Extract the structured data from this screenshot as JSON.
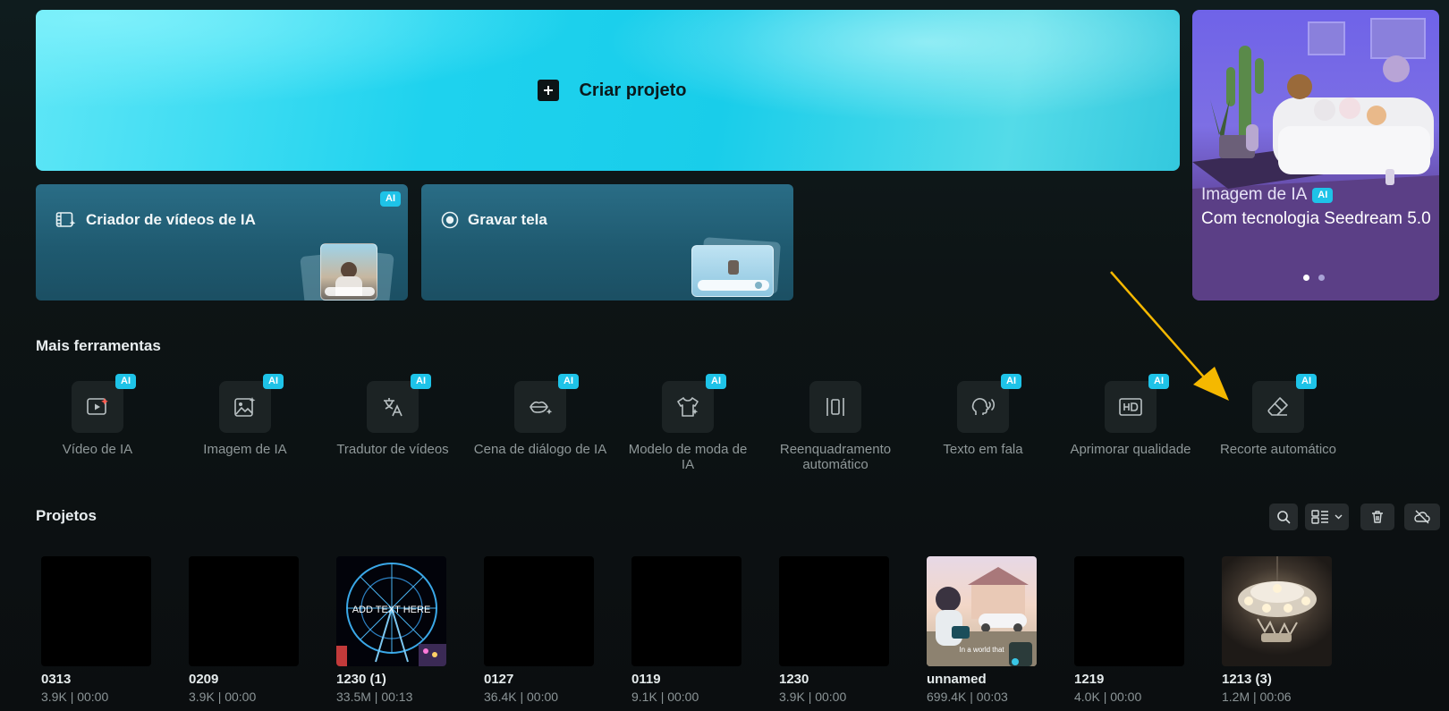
{
  "hero": {
    "label": "Criar projeto"
  },
  "cards": [
    {
      "label": "Criador de vídeos de IA",
      "badge": "AI"
    },
    {
      "label": "Gravar tela"
    }
  ],
  "promo": {
    "subtitle": "Imagem de IA",
    "badge": "AI",
    "title": "Com tecnologia Seedream 5.0",
    "slides": 2,
    "active_slide": 1
  },
  "tools_section": {
    "title": "Mais ferramentas",
    "items": [
      {
        "label": "Vídeo de IA",
        "badge": "AI",
        "icon": "video-play-icon"
      },
      {
        "label": "Imagem de IA",
        "badge": "AI",
        "icon": "image-sparkle-icon"
      },
      {
        "label": "Tradutor de vídeos",
        "badge": "AI",
        "icon": "translate-icon"
      },
      {
        "label": "Cena de diálogo de IA",
        "badge": "AI",
        "icon": "lips-icon"
      },
      {
        "label": "Modelo de moda de IA",
        "badge": "AI",
        "icon": "shirt-sparkle-icon"
      },
      {
        "label": "Reenquadramento automático",
        "badge": "",
        "icon": "reframe-icon"
      },
      {
        "label": "Texto em fala",
        "badge": "AI",
        "icon": "speech-head-icon"
      },
      {
        "label": "Aprimorar qualidade",
        "badge": "AI",
        "icon": "hd-icon"
      },
      {
        "label": "Recorte automático",
        "badge": "AI",
        "icon": "eraser-icon"
      }
    ]
  },
  "projects_section": {
    "title": "Projetos",
    "items": [
      {
        "name": "0313",
        "meta": "3.9K | 00:00"
      },
      {
        "name": "0209",
        "meta": "3.9K | 00:00"
      },
      {
        "name": "1230 (1)",
        "meta": "33.5M | 00:13",
        "overlay": "ADD TEXT HERE"
      },
      {
        "name": "0127",
        "meta": "36.4K | 00:00"
      },
      {
        "name": "0119",
        "meta": "9.1K | 00:00"
      },
      {
        "name": "1230",
        "meta": "3.9K | 00:00"
      },
      {
        "name": "unnamed",
        "meta": "699.4K | 00:03",
        "overlay": "In a world that"
      },
      {
        "name": "1219",
        "meta": "4.0K | 00:00"
      },
      {
        "name": "1213 (3)",
        "meta": "1.2M | 00:06"
      }
    ]
  },
  "colors": {
    "accent": "#1ec3e8",
    "arrow": "#f5b800"
  }
}
